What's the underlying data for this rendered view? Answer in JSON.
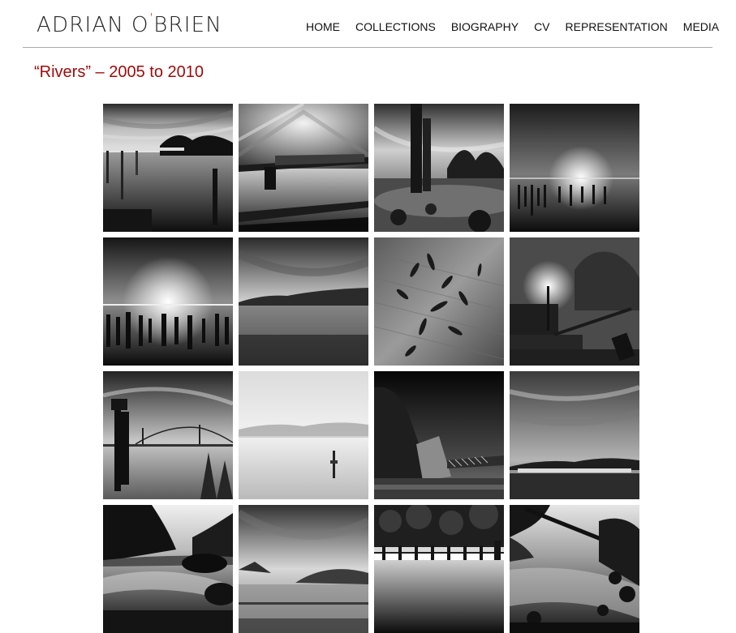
{
  "header": {
    "logo_first": "ADRIAN",
    "logo_o": "O",
    "logo_apostrophe": "'",
    "logo_rest": "BRIEN"
  },
  "nav": {
    "items": [
      {
        "label": "HOME"
      },
      {
        "label": "COLLECTIONS"
      },
      {
        "label": "BIOGRAPHY"
      },
      {
        "label": "CV"
      },
      {
        "label": "REPRESENTATION"
      },
      {
        "label": "MEDIA"
      }
    ]
  },
  "page": {
    "title": "“Rivers” – 2005 to 2010"
  },
  "colors": {
    "title_red": "#9e0a0a",
    "logo_accent_red": "#b00000",
    "divider_gray": "#a9a9a9"
  },
  "gallery": {
    "thumbnails": [
      {
        "scene": "bridge-dock-reflection"
      },
      {
        "scene": "railway-bridge-long-exposure"
      },
      {
        "scene": "broken-pilings-shore"
      },
      {
        "scene": "pilings-glow-horizon"
      },
      {
        "scene": "dark-pilings-bright-horizon"
      },
      {
        "scene": "misty-treeline-river"
      },
      {
        "scene": "fish-on-wooden-surface"
      },
      {
        "scene": "foggy-dock-lamp"
      },
      {
        "scene": "marker-suspension-bridge"
      },
      {
        "scene": "foggy-reeds-white"
      },
      {
        "scene": "rock-cliff-rail-bridge"
      },
      {
        "scene": "streaked-sky-low-shore"
      },
      {
        "scene": "forest-river-rocks"
      },
      {
        "scene": "mountain-mist-lake"
      },
      {
        "scene": "weir-dam-forest"
      },
      {
        "scene": "fallen-tree-rapids"
      }
    ]
  }
}
